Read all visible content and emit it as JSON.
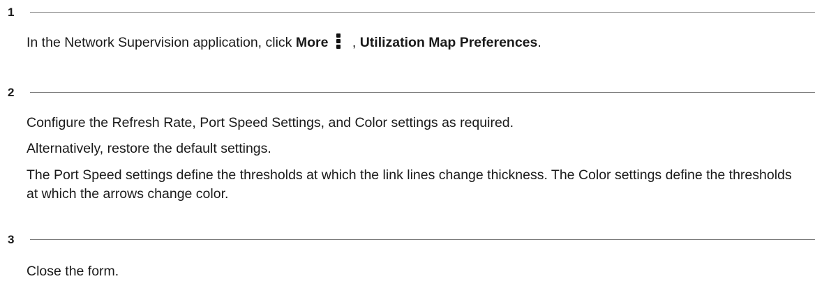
{
  "steps": [
    {
      "number": "1",
      "instruction": {
        "prefix": "In the Network Supervision application, click ",
        "more_label": "More",
        "separator": " , ",
        "menu_item_label": "Utilization Map Preferences",
        "suffix": ".",
        "icon": "more-vertical-icon"
      }
    },
    {
      "number": "2",
      "paragraphs": [
        "Configure the Refresh Rate, Port Speed Settings, and Color settings as required.",
        "Alternatively, restore the default settings.",
        "The Port Speed settings define the thresholds at which the link lines change thickness. The Color settings define the thresholds at which the arrows change color."
      ]
    },
    {
      "number": "3",
      "paragraphs": [
        "Close the form."
      ]
    }
  ]
}
